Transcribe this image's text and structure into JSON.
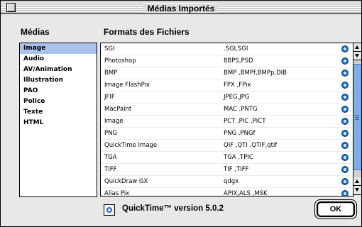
{
  "window": {
    "title": "Médias Importés"
  },
  "columns": {
    "left_title": "Médias",
    "right_title": "Formats des Fichiers"
  },
  "sidebar": {
    "items": [
      {
        "label": "Image",
        "selected": true
      },
      {
        "label": "Audio"
      },
      {
        "label": "AV/Animation"
      },
      {
        "label": "Illustration"
      },
      {
        "label": "PAO"
      },
      {
        "label": "Police"
      },
      {
        "label": "Texte"
      },
      {
        "label": "HTML"
      }
    ]
  },
  "formats": [
    {
      "name": "SGI",
      "ext": ".SGI,SGI"
    },
    {
      "name": "Photoshop",
      "ext": "8BPS,PSD"
    },
    {
      "name": "BMP",
      "ext": "BMP ,BMPf,BMPp,DIB"
    },
    {
      "name": "Image FlashPix",
      "ext": "FPX ,FPix"
    },
    {
      "name": "JFIF",
      "ext": "JPEG,JPG"
    },
    {
      "name": "MacPaint",
      "ext": "MAC ,PNTG"
    },
    {
      "name": "Image",
      "ext": "PCT ,PIC ,PICT"
    },
    {
      "name": "PNG",
      "ext": "PNG ,PNGf"
    },
    {
      "name": "QuickTime Image",
      "ext": "QIF ,QTI ,QTIF,qtif"
    },
    {
      "name": "TGA",
      "ext": "TGA ,TPIC"
    },
    {
      "name": "TIFF",
      "ext": "TIF ,TIFF"
    },
    {
      "name": "QuickDraw GX",
      "ext": "qdgx"
    },
    {
      "name": "Alias Pix",
      "ext": "APIX,ALS ,MSK"
    }
  ],
  "footer": {
    "version": "QuickTime™ version 5.0.2",
    "ok_label": "OK"
  },
  "colors": {
    "selection": "#aac3ec",
    "scroll_thumb": "#7eaee6",
    "magnifier": "#1a70c8"
  },
  "icons": {
    "row_action": "magnifier-icon",
    "footer": "quicktime-icon"
  }
}
